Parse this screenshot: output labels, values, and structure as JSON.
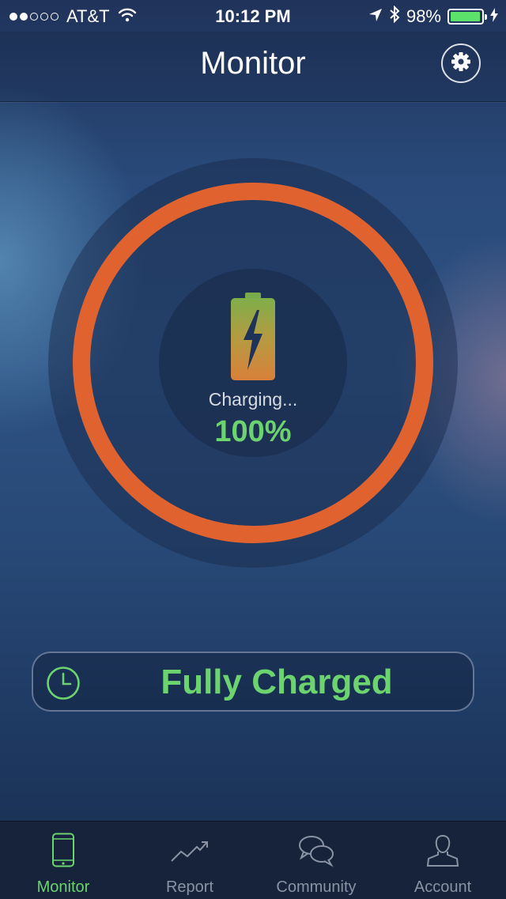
{
  "status_bar": {
    "signal_dots": [
      true,
      true,
      false,
      false,
      false
    ],
    "carrier": "AT&T",
    "time": "10:12 PM",
    "battery_percent": "98%",
    "battery_level": 0.98,
    "icons": [
      "wifi-icon",
      "location-arrow-icon",
      "bluetooth-icon",
      "battery-icon",
      "charging-bolt-icon"
    ]
  },
  "header": {
    "title": "Monitor",
    "settings_icon": "gear-icon"
  },
  "charge": {
    "status_label": "Charging...",
    "percent_label": "100%",
    "level": 1.0,
    "ring_color": "#e0622f",
    "battery_icon": "battery-bolt-icon"
  },
  "status_banner": {
    "icon": "clock-icon",
    "text": "Fully Charged",
    "color": "#6cd36f"
  },
  "tabs": [
    {
      "label": "Monitor",
      "icon": "phone-icon",
      "active": true
    },
    {
      "label": "Report",
      "icon": "trend-chart-icon",
      "active": false
    },
    {
      "label": "Community",
      "icon": "chat-bubbles-icon",
      "active": false
    },
    {
      "label": "Account",
      "icon": "person-icon",
      "active": false
    }
  ],
  "colors": {
    "accent": "#6cd36f",
    "ring": "#e0622f",
    "inactive": "#8a93a3"
  }
}
